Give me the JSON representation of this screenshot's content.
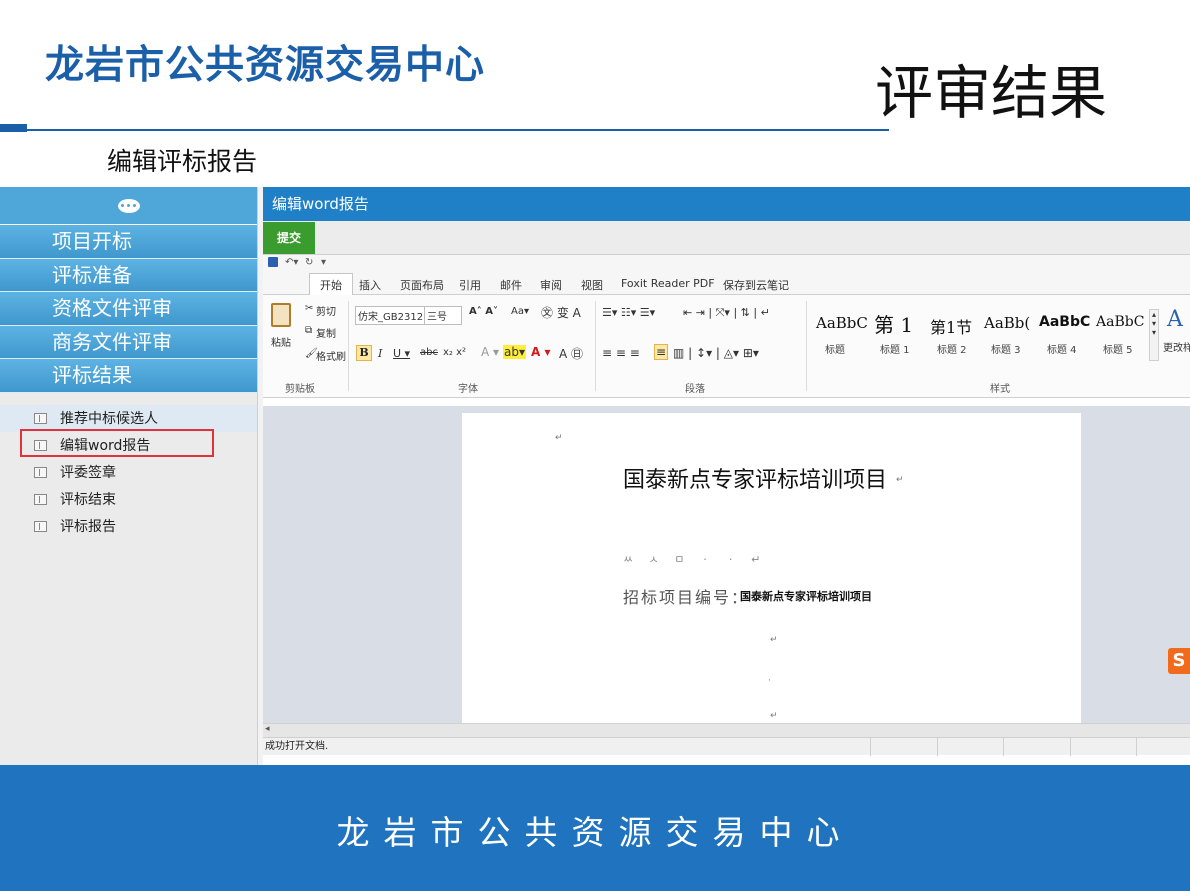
{
  "slide": {
    "title": "龙岩市公共资源交易中心",
    "section": "评审结果",
    "subtitle": "编辑评标报告",
    "footer": "龙岩市公共资源交易中心"
  },
  "nav": {
    "items": [
      "项目开标",
      "评标准备",
      "资格文件评审",
      "商务文件评审",
      "评标结果"
    ],
    "sub_items": [
      "推荐中标候选人",
      "编辑word报告",
      "评委签章",
      "评标结束",
      "评标报告"
    ]
  },
  "window": {
    "title": "编辑word报告",
    "submit_label": "提交"
  },
  "ribbon": {
    "tabs": [
      "开始",
      "插入",
      "页面布局",
      "引用",
      "邮件",
      "审阅",
      "视图",
      "Foxit Reader PDF",
      "保存到云笔记"
    ],
    "clipboard": {
      "cut": "剪切",
      "copy": "复制",
      "paste": "粘贴",
      "format_painter": "格式刷",
      "label": "剪贴板"
    },
    "font": {
      "name": "仿宋_GB2312",
      "size": "三号",
      "label": "字体"
    },
    "paragraph_label": "段落",
    "styles": {
      "label": "样式",
      "change": "更改样",
      "items": [
        {
          "preview": "AaBbC",
          "name": "标题"
        },
        {
          "preview": "第 1",
          "name": "标题 1"
        },
        {
          "preview": "第1节",
          "name": "标题 2"
        },
        {
          "preview": "AaBb(",
          "name": "标题 3"
        },
        {
          "preview": "AaBbC",
          "name": "标题 4"
        },
        {
          "preview": "AaBbC",
          "name": "标题 5"
        }
      ]
    }
  },
  "document": {
    "title": "国泰新点专家评标培训项目",
    "code_label": "招标项目编号：",
    "code_value": "国泰新点专家评标培训项目"
  },
  "status_text": "成功打开文档."
}
